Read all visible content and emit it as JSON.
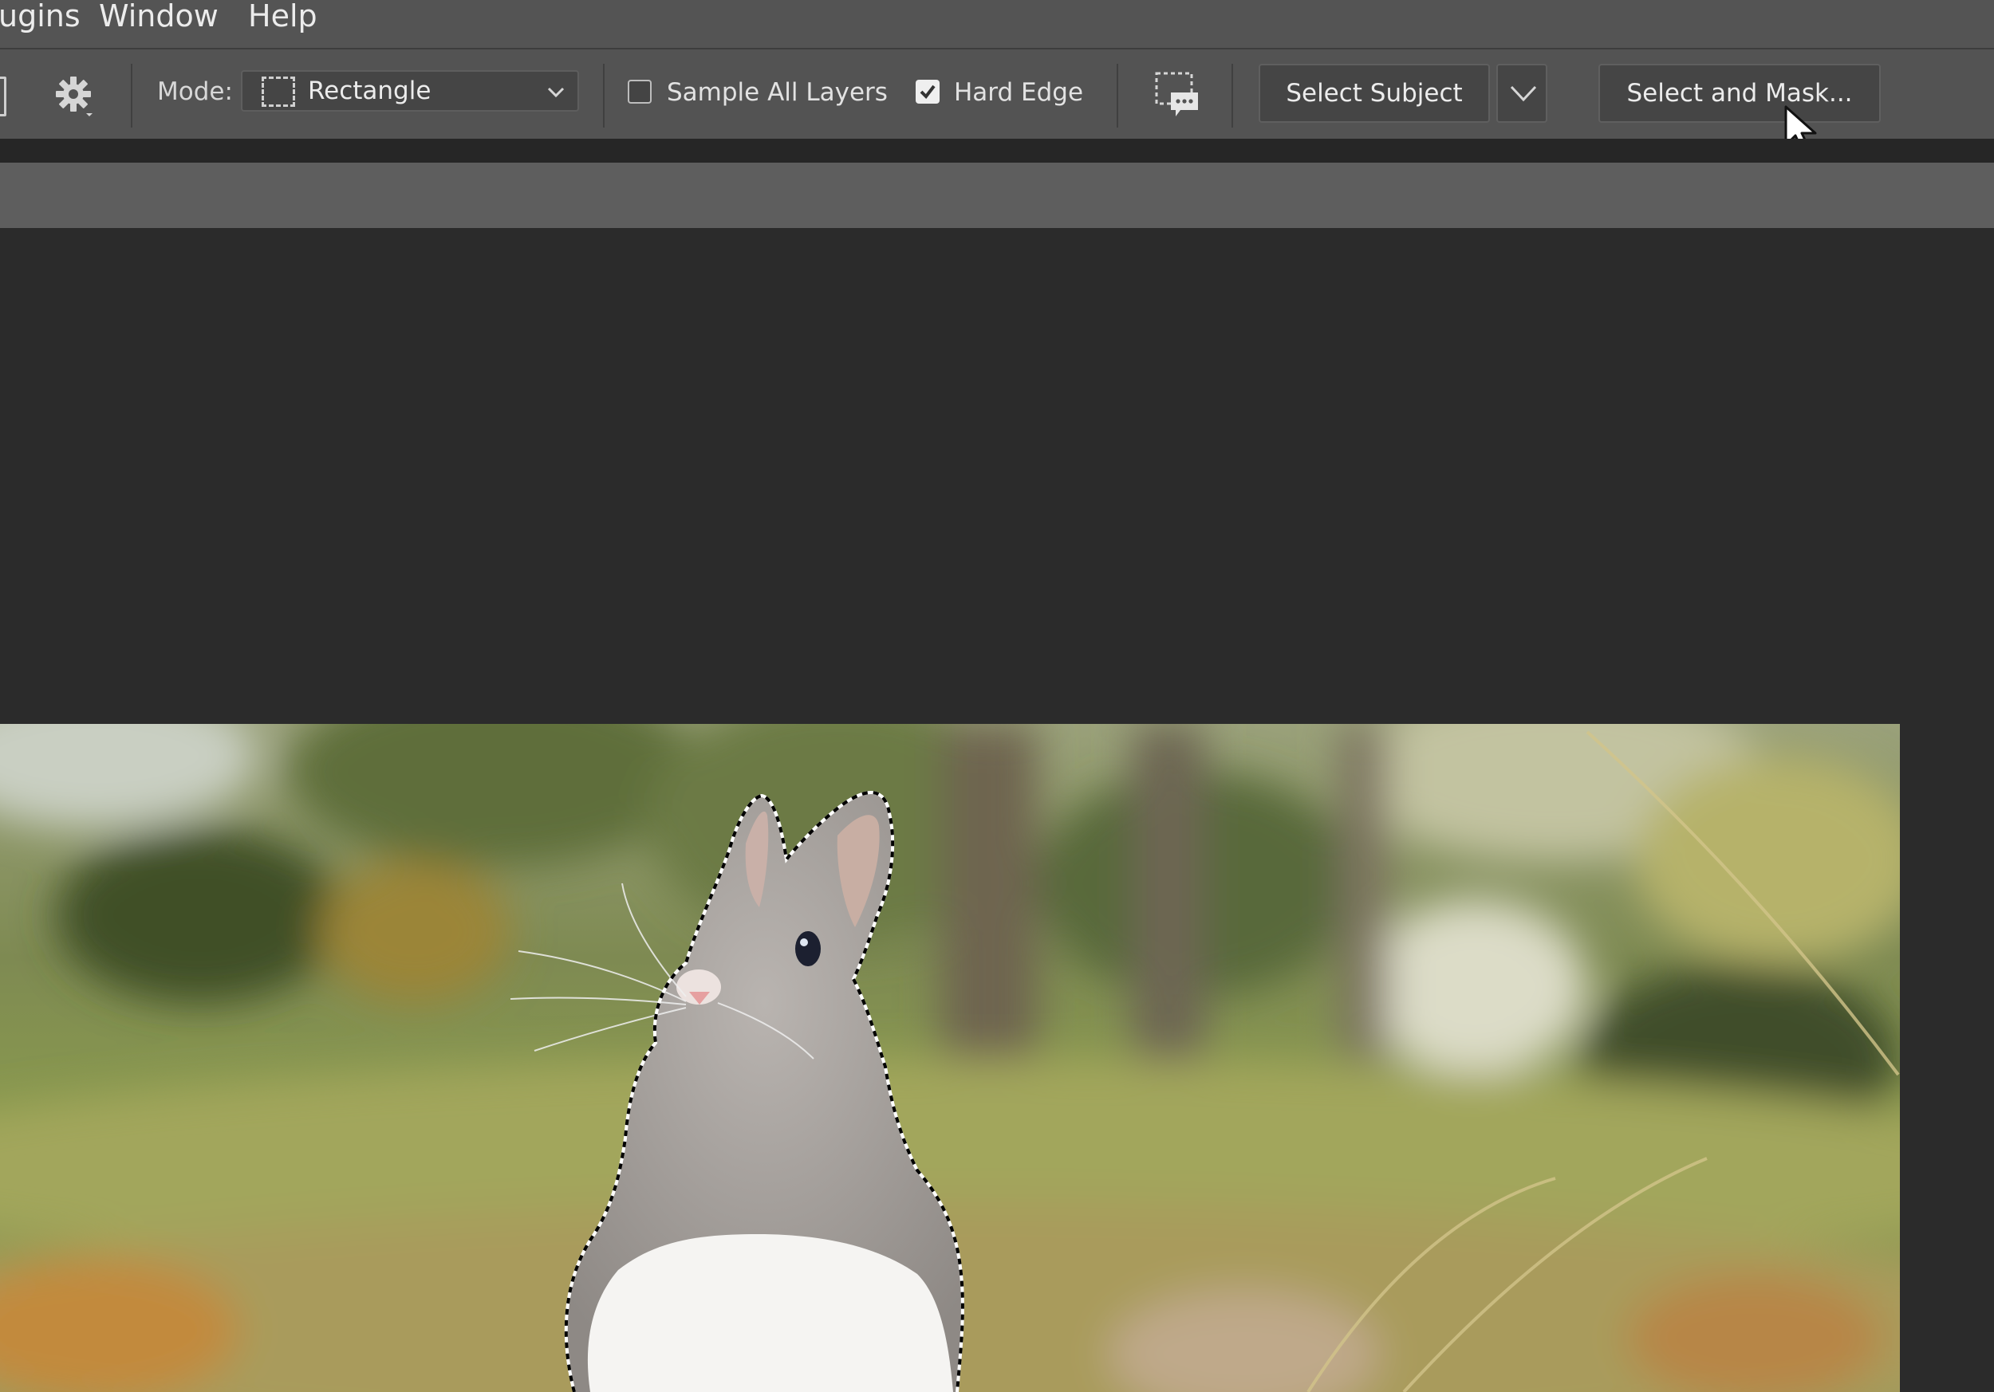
{
  "menubar": {
    "items": [
      "ugins",
      "Window",
      "Help"
    ]
  },
  "options_bar": {
    "mode_label": "Mode:",
    "mode_value": "Rectangle",
    "sample_all_layers": {
      "label": "Sample All Layers",
      "checked": false
    },
    "hard_edge": {
      "label": "Hard Edge",
      "checked": true
    },
    "select_subject_label": "Select Subject",
    "select_and_mask_label": "Select and Mask..."
  },
  "icons": {
    "tool": "tool-edge-icon",
    "settings": "gear-icon",
    "mode": "rectangle-marquee-icon",
    "refine": "selection-speech-bubble-icon",
    "dropdown": "chevron-down-icon",
    "pointer": "mouse-cursor-icon"
  },
  "canvas": {
    "image_subject": "rabbit photo with active selection outline"
  },
  "colors": {
    "menubar_bg": "#545454",
    "options_bg": "#535353",
    "canvas_bg": "#2b2b2b",
    "tabbar_bg": "#5e5e5e"
  }
}
